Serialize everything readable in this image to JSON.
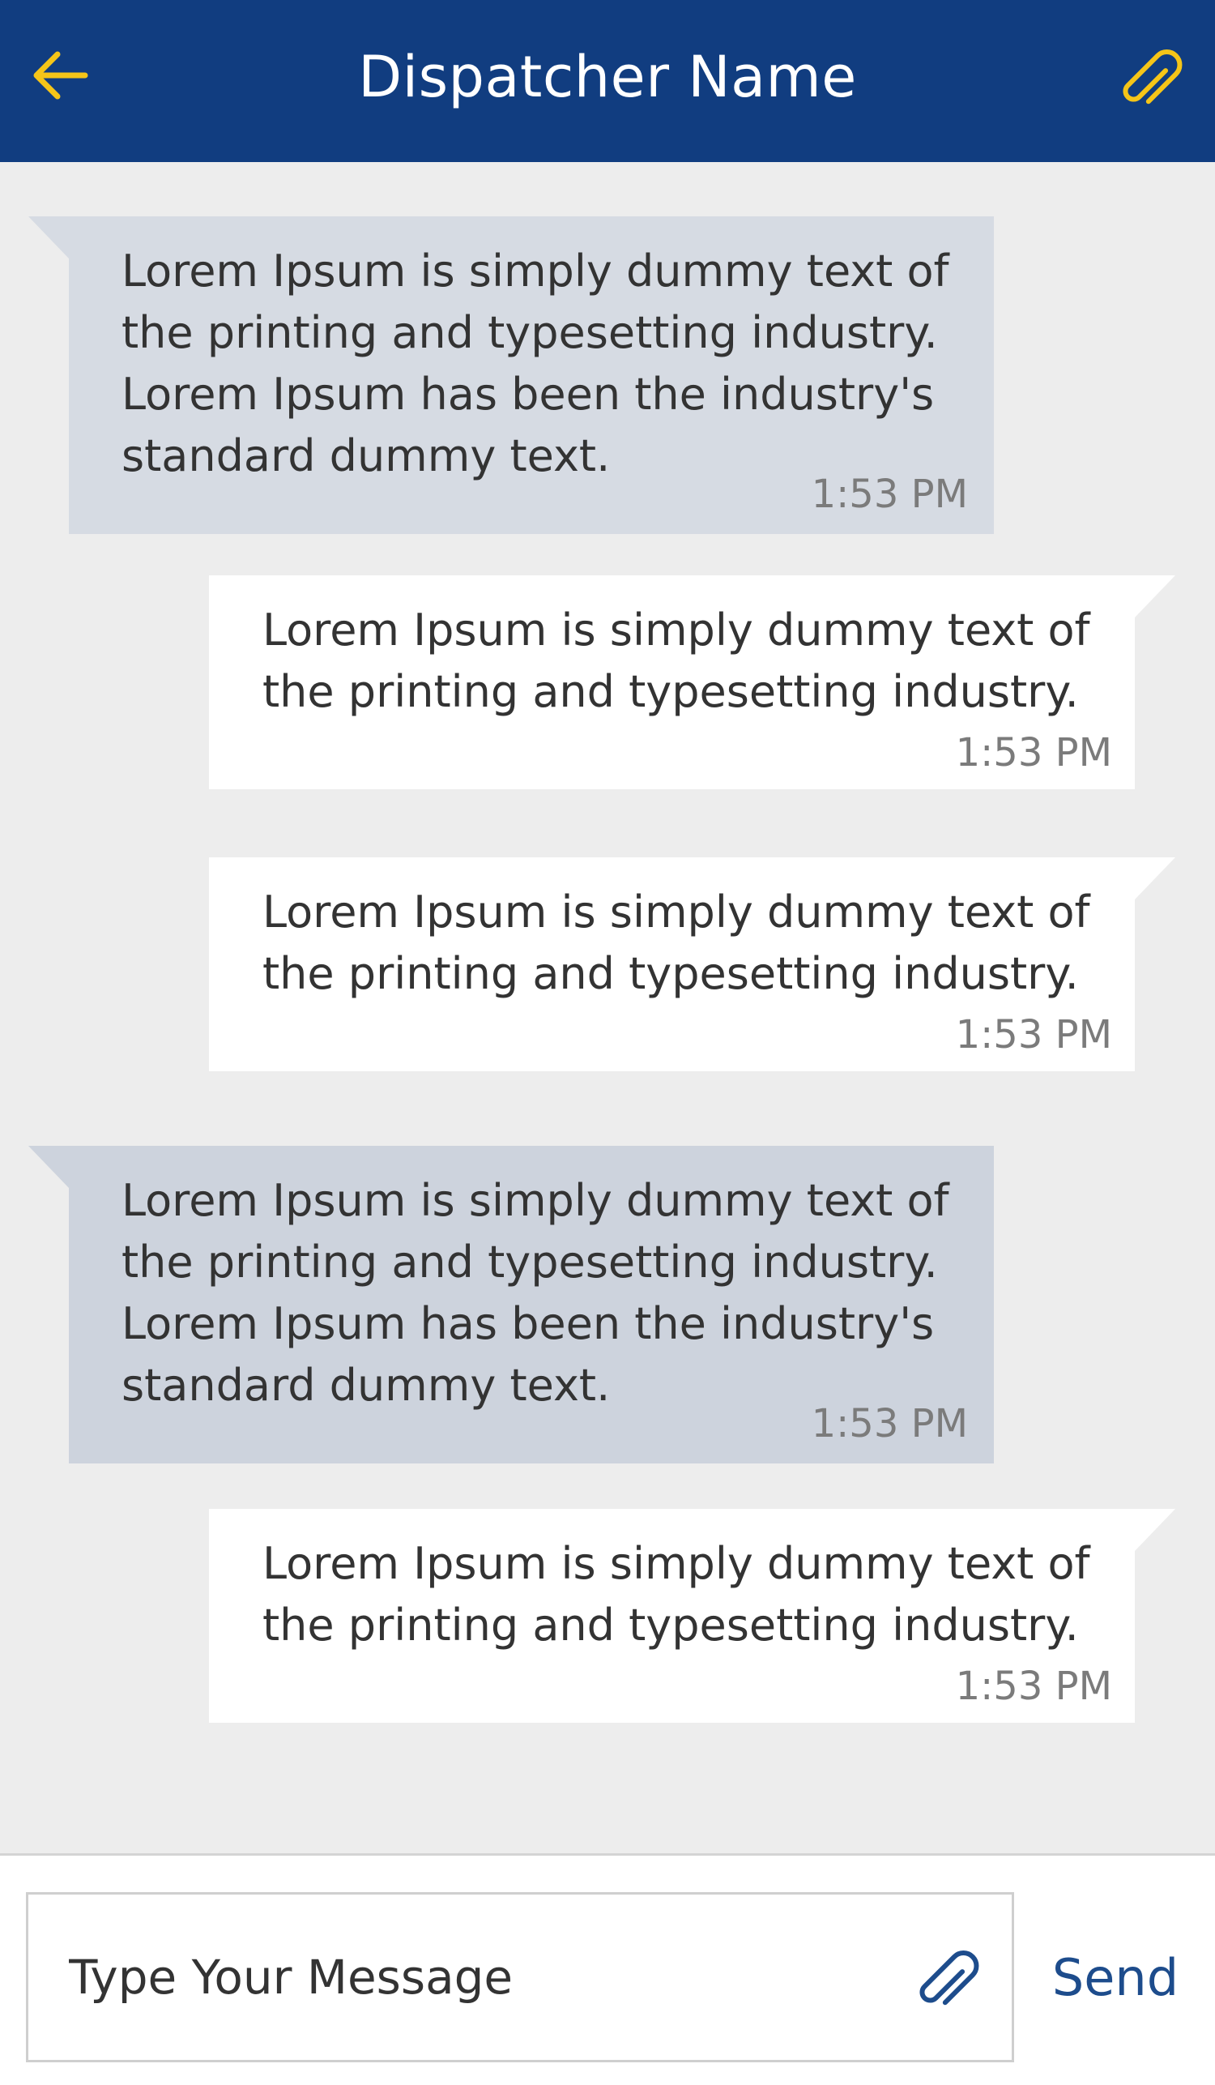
{
  "header": {
    "title": "Dispatcher Name",
    "back_icon": "arrow-left-icon",
    "attach_icon": "paperclip-icon",
    "background_color": "#113d80",
    "accent_color": "#f5c518"
  },
  "messages": [
    {
      "direction": "incoming",
      "text": "Lorem Ipsum is simply dummy text of the printing and typesetting industry. Lorem Ipsum has been the industry's standard dummy text.",
      "time": "1:53 PM"
    },
    {
      "direction": "outgoing",
      "text": "Lorem Ipsum is simply dummy text of the printing and typesetting industry.",
      "time": "1:53 PM"
    },
    {
      "direction": "outgoing",
      "text": "Lorem Ipsum is simply dummy text of the printing and typesetting industry.",
      "time": "1:53 PM"
    },
    {
      "direction": "incoming",
      "text": "Lorem Ipsum is simply dummy text of the printing and typesetting industry. Lorem Ipsum has been the industry's standard dummy text.",
      "time": "1:53 PM"
    },
    {
      "direction": "outgoing",
      "text": "Lorem Ipsum is simply dummy text of the printing and typesetting industry.",
      "time": "1:53 PM"
    }
  ],
  "composer": {
    "placeholder": "Type Your Message",
    "value": "",
    "attach_icon": "paperclip-icon",
    "send_label": "Send",
    "send_color": "#1d4c8c"
  }
}
